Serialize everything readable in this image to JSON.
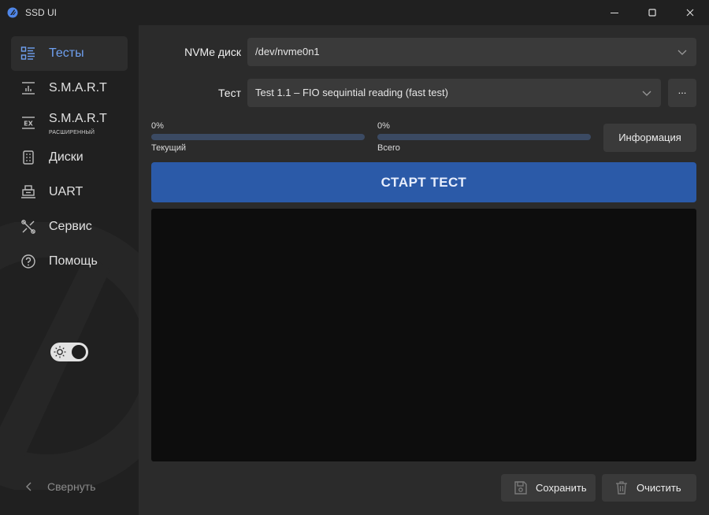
{
  "window": {
    "title": "SSD UI",
    "minimize_icon": "minimize-icon",
    "maximize_icon": "maximize-icon",
    "close_icon": "close-icon"
  },
  "sidebar": {
    "items": [
      {
        "label": "Тесты",
        "sub": "",
        "icon": "tests-list-icon",
        "active": true
      },
      {
        "label": "S.M.A.R.T",
        "sub": "",
        "icon": "chart-icon",
        "active": false
      },
      {
        "label": "S.M.A.R.T",
        "sub": "РАСШИРЕННЫЙ",
        "icon": "ex-icon",
        "active": false
      },
      {
        "label": "Диски",
        "sub": "",
        "icon": "disk-icon",
        "active": false
      },
      {
        "label": "UART",
        "sub": "",
        "icon": "uart-icon",
        "active": false
      },
      {
        "label": "Сервис",
        "sub": "",
        "icon": "service-icon",
        "active": false
      },
      {
        "label": "Помощь",
        "sub": "",
        "icon": "help-icon",
        "active": false
      }
    ],
    "theme_toggle_icon": "sun-icon",
    "collapse_label": "Свернуть"
  },
  "main": {
    "disk_label": "NVMe диск",
    "disk_value": "/dev/nvme0n1",
    "test_label": "Тест",
    "test_value": "Test 1.1 – FIO sequintial reading (fast test)",
    "more_label": "...",
    "progress_current": {
      "percent_text": "0%",
      "value": 0,
      "caption": "Текущий"
    },
    "progress_total": {
      "percent_text": "0%",
      "value": 0,
      "caption": "Всего"
    },
    "info_label": "Информация",
    "start_label": "СТАРТ ТЕСТ",
    "save_label": "Сохранить",
    "clear_label": "Очистить"
  },
  "colors": {
    "accent": "#2b5aa8",
    "active_text": "#6fa0f0",
    "sidebar_bg": "#202020",
    "main_bg": "#2b2b2b",
    "log_bg": "#0d0d0d"
  }
}
